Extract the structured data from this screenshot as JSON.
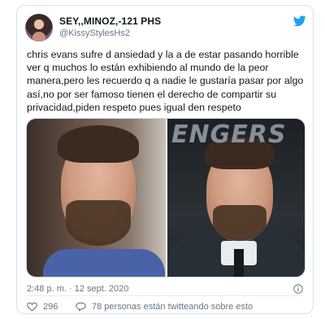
{
  "tweet": {
    "display_name": "SEY,,MINOZ,-121 PHS",
    "handle": "@KissyStylesHs2",
    "text": "chris evans sufre d ansiedad y la a de estar pasando horrible\nver q muchos lo están exhibiendo al mundo de la peor\nmanera,pero les recuerdo q a nadie le gustaría pasar por algo\nasí,no por ser famoso tienen el derecho de compartir su\nprivacidad,piden respeto pues igual den respeto",
    "timestamp": "2:48 p. m. · 12 sept. 2020",
    "like_count": "296",
    "comment_text": "78 personas están twitteando sobre esto",
    "right_photo_sign": "ENGERS"
  },
  "colors": {
    "twitter_blue": "#1da1f2",
    "secondary_text": "#657786",
    "border": "#d9e1e8"
  },
  "icons": {
    "brand": "twitter-bird-icon",
    "like": "heart-icon",
    "reply": "comment-bubble-icon",
    "info": "info-icon"
  }
}
